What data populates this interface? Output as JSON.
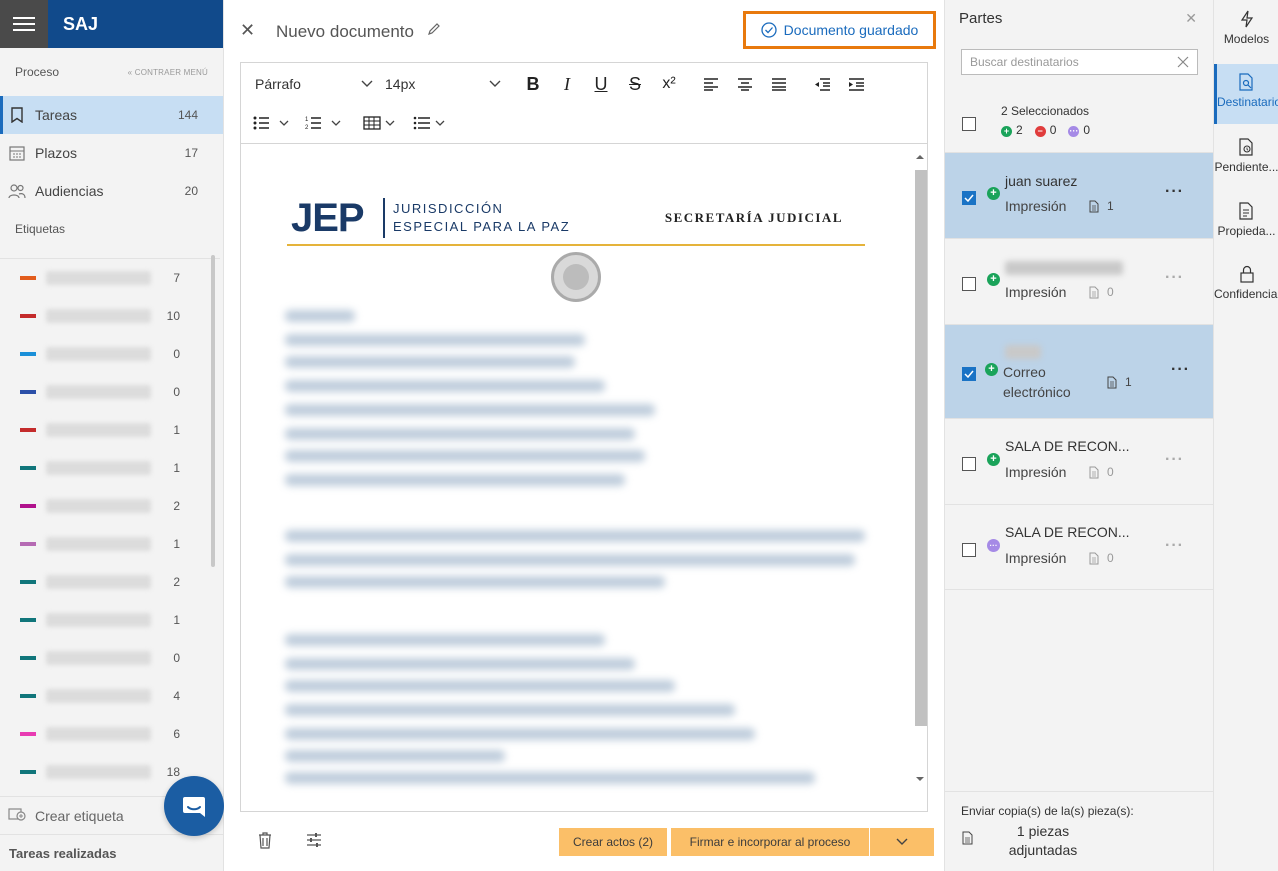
{
  "sidebar": {
    "brand": "SAJ",
    "section_title": "Proceso",
    "collapse_label": "CONTRAER MENÚ",
    "nav": [
      {
        "label": "Tareas",
        "count": "144"
      },
      {
        "label": "Plazos",
        "count": "17"
      },
      {
        "label": "Audiencias",
        "count": "20"
      }
    ],
    "labels_title": "Etiquetas",
    "labels": [
      {
        "color": "#e25c1c",
        "count": "7"
      },
      {
        "color": "#c42b2b",
        "count": "10"
      },
      {
        "color": "#1a8fd8",
        "count": "0"
      },
      {
        "color": "#2b4fa8",
        "count": "0"
      },
      {
        "color": "#c42b2b",
        "count": "1"
      },
      {
        "color": "#10757a",
        "count": "1"
      },
      {
        "color": "#b0118c",
        "count": "2"
      },
      {
        "color": "#b56ab3",
        "count": "1"
      },
      {
        "color": "#10757a",
        "count": "2"
      },
      {
        "color": "#10757a",
        "count": "1"
      },
      {
        "color": "#10757a",
        "count": "0"
      },
      {
        "color": "#10757a",
        "count": "4"
      },
      {
        "color": "#e83bb2",
        "count": "6"
      },
      {
        "color": "#10757a",
        "count": "18"
      }
    ],
    "create_label": "Crear etiqueta",
    "done_tasks": "Tareas realizadas"
  },
  "editor": {
    "title": "Nuevo documento",
    "saved_status": "Documento guardado",
    "paragraph_style": "Párrafo",
    "font_size": "14px",
    "doc": {
      "logo": "JEP",
      "org_line1": "JURISDICCIÓN",
      "org_line2": "ESPECIAL PARA LA PAZ",
      "office": "SECRETARÍA JUDICIAL"
    },
    "btn_create": "Crear actos (2)",
    "btn_sign": "Firmar e incorporar al proceso"
  },
  "partes": {
    "title": "Partes",
    "search_placeholder": "Buscar destinatarios",
    "selected_text": "2 Seleccionados",
    "counts": {
      "added": "2",
      "removed": "0",
      "pending": "0"
    },
    "items": [
      {
        "name": "juan suarez",
        "type": "Impresión",
        "docs": "1",
        "checked": true
      },
      {
        "name": "",
        "type": "Impresión",
        "docs": "0",
        "checked": false
      },
      {
        "name": "",
        "type_line1": "Correo",
        "type_line2": "electrónico",
        "docs": "1",
        "checked": true
      },
      {
        "name": "SALA DE RECON...",
        "type": "Impresión",
        "docs": "0",
        "checked": false
      },
      {
        "name": "SALA DE RECON...",
        "type": "Impresión",
        "docs": "0",
        "checked": false
      }
    ],
    "footer_label": "Enviar copia(s) de la(s) pieza(s):",
    "footer_value": "1 piezas adjuntadas"
  },
  "rail": [
    {
      "label": "Modelos"
    },
    {
      "label": "Destinatarios"
    },
    {
      "label": "Pendiente..."
    },
    {
      "label": "Propieda..."
    },
    {
      "label": "Confidencial"
    }
  ],
  "colors": {
    "brand_blue": "#114a8b",
    "accent": "#1a6bbd",
    "highlight_orange": "#e8790d",
    "button_orange": "#fbbf68",
    "selected_row": "#bcd3e8"
  }
}
